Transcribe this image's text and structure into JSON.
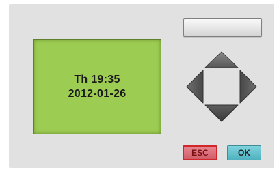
{
  "display": {
    "line1": "Th 19:35",
    "line2": "2012-01-26",
    "background_color": "#9dcc52"
  },
  "keys": {
    "esc_label": "ESC",
    "ok_label": "OK",
    "esc_color": "#d2262a",
    "ok_color": "#4fb1bf"
  },
  "icons": {
    "up": "arrow-up-icon",
    "down": "arrow-down-icon",
    "left": "arrow-left-icon",
    "right": "arrow-right-icon"
  }
}
